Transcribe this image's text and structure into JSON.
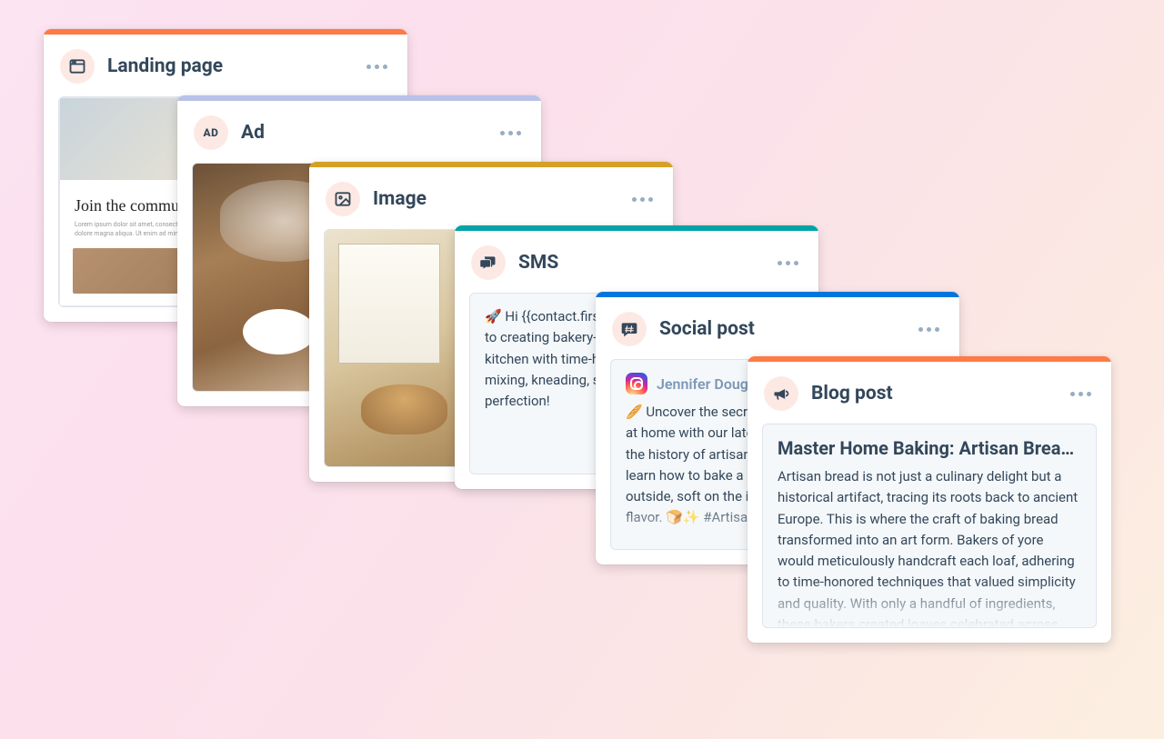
{
  "cards": {
    "landing": {
      "title": "Landing page",
      "accent": "#ff7a45",
      "sample_title": "Join the community",
      "sample_text": "Lorem ipsum dolor sit amet, consectetur adipiscing elit, sed do eiusmod tempor incididunt ut labore et dolore magna aliqua. Ut enim ad minim veniam, quis nostrud exercitation."
    },
    "ad": {
      "title": "Ad",
      "accent": "#b8c1e8",
      "icon_label": "AD"
    },
    "image": {
      "title": "Image",
      "accent": "#d6a027"
    },
    "sms": {
      "title": "SMS",
      "accent": "#00a4a6",
      "body": "🚀 Hi {{contact.firstname}}, discover the secrets to creating bakery-style artisan bread in your kitchen with time-honored techniques. Master mixing, kneading, scoring, and baking your loaf to perfection!"
    },
    "social": {
      "title": "Social post",
      "accent": "#0077dd",
      "author": "Jennifer Douglas",
      "body": "🥖 Uncover the secrets of crafting artisan bread at home with our latest blog post! From exploring the history of artisan bread to key techniques, learn how to bake a loaf that's crispy on the outside, soft on the inside, and bursting with flavor. 🍞✨ #ArtisanBread #HomeBaking"
    },
    "blog": {
      "title": "Blog post",
      "accent": "#ff7a45",
      "headline": "Master Home Baking: Artisan Bread Techniques",
      "body": "Artisan bread is not just a culinary delight but a historical artifact, tracing its roots back to ancient Europe. This is where the craft of baking bread transformed into an art form. Bakers of yore would meticulously handcraft each loaf, adhering to time-honored techniques that valued simplicity and quality. With only a handful of ingredients, these bakers created loaves celebrated across generations."
    }
  }
}
